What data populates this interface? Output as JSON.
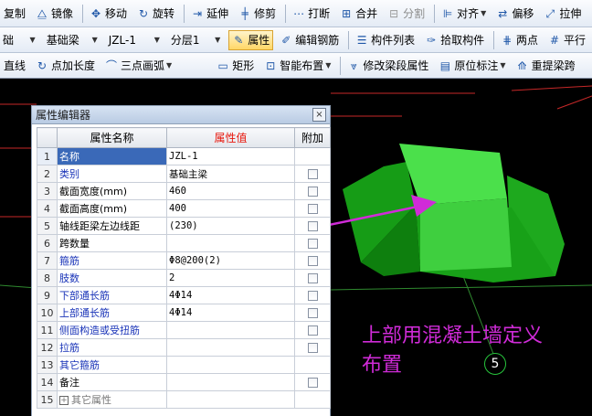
{
  "toolbar1": [
    {
      "label": "复制",
      "icon": "copy-icon",
      "glyph": ""
    },
    {
      "label": "镜像",
      "icon": "mirror-icon",
      "glyph": "⧋"
    },
    {
      "label": "移动",
      "icon": "move-icon",
      "glyph": "✥"
    },
    {
      "label": "旋转",
      "icon": "rotate-icon",
      "glyph": "↻"
    },
    {
      "label": "延伸",
      "icon": "extend-icon",
      "glyph": "⇥"
    },
    {
      "label": "修剪",
      "icon": "trim-icon",
      "glyph": "╪"
    },
    {
      "label": "打断",
      "icon": "break-icon",
      "glyph": "⋯"
    },
    {
      "label": "合并",
      "icon": "merge-icon",
      "glyph": "⊞"
    },
    {
      "label": "分割",
      "icon": "split-icon",
      "glyph": "⊟"
    },
    {
      "label": "对齐",
      "icon": "align-icon",
      "glyph": "⊫"
    },
    {
      "label": "偏移",
      "icon": "offset-icon",
      "glyph": "⇄"
    },
    {
      "label": "拉伸",
      "icon": "stretch-icon",
      "glyph": "⤢"
    }
  ],
  "toolbar2": {
    "combo1": "础",
    "combo2": "基础梁",
    "combo3": "JZL-1",
    "combo4": "分层1",
    "attribute_btn": "属性",
    "edit_rebar_btn": "编辑钢筋",
    "component_list_btn": "构件列表",
    "pick_component_btn": "拾取构件",
    "two_point_btn": "两点",
    "parallel_btn": "平行"
  },
  "toolbar3": {
    "line_btn": "直线",
    "point_length_btn": "点加长度",
    "arc_btn": "三点画弧",
    "rect_btn": "矩形",
    "smart_layout_btn": "智能布置",
    "modify_span_btn": "修改梁段属性",
    "origin_mark_btn": "原位标注",
    "reextract_btn": "重提梁跨"
  },
  "panel": {
    "title": "属性编辑器",
    "close": "×",
    "col_name": "属性名称",
    "col_value": "属性值",
    "col_attach": "附加",
    "rows": [
      {
        "no": "1",
        "name": "名称",
        "value": "JZL-1",
        "checkbox": false
      },
      {
        "no": "2",
        "name": "类别",
        "value": "基础主梁",
        "checkbox": true
      },
      {
        "no": "3",
        "name": "截面宽度(mm)",
        "value": "460",
        "checkbox": true
      },
      {
        "no": "4",
        "name": "截面高度(mm)",
        "value": "400",
        "checkbox": true
      },
      {
        "no": "5",
        "name": "轴线距梁左边线距",
        "value": "(230)",
        "checkbox": true
      },
      {
        "no": "6",
        "name": "跨数量",
        "value": "",
        "checkbox": true
      },
      {
        "no": "7",
        "name": "箍筋",
        "value": "Φ8@200(2)",
        "checkbox": true
      },
      {
        "no": "8",
        "name": "肢数",
        "value": "2",
        "checkbox": true
      },
      {
        "no": "9",
        "name": "下部通长筋",
        "value": "4Φ14",
        "checkbox": true
      },
      {
        "no": "10",
        "name": "上部通长筋",
        "value": "4Φ14",
        "checkbox": true
      },
      {
        "no": "11",
        "name": "侧面构造或受扭筋",
        "value": "",
        "checkbox": true
      },
      {
        "no": "12",
        "name": "拉筋",
        "value": "",
        "checkbox": true
      },
      {
        "no": "13",
        "name": "其它箍筋",
        "value": "",
        "checkbox": false
      },
      {
        "no": "14",
        "name": "备注",
        "value": "",
        "checkbox": true
      },
      {
        "no": "15",
        "name": "其它属性",
        "value": "",
        "checkbox": false
      }
    ]
  },
  "annotation": {
    "line1": "上部用混凝土墙定义",
    "line2": "布置"
  },
  "axis_label": "5",
  "colors": {
    "annotation": "#d02bd8",
    "highlight_circle": "#e0202a",
    "block_light": "#4be04b",
    "block_dark": "#169c16"
  }
}
